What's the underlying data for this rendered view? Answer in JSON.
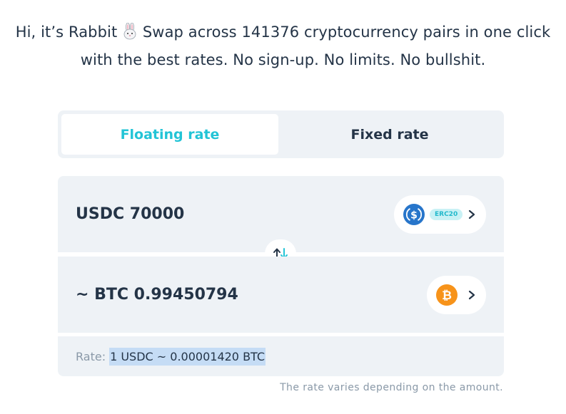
{
  "intro": {
    "line1_before": "Hi, it’s Rabbit",
    "line1_after": "Swap across 141376 cryptocurrency pairs in one click",
    "line2": "with the best rates. No sign-up. No limits. No bullshit."
  },
  "rate_toggle": {
    "floating_label": "Floating rate",
    "fixed_label": "Fixed rate",
    "selected": "Floating rate"
  },
  "send": {
    "amount_text": "USDC 70000",
    "coin_icon": "usdc-icon",
    "network_badge": "ERC20",
    "coin_color": "#2775ca"
  },
  "receive": {
    "amount_text": "~ BTC 0.99450794",
    "coin_icon": "bitcoin-icon",
    "coin_color": "#f7931a"
  },
  "rate": {
    "label": "Rate:",
    "value": "1 USDC ~ 0.00001420 BTC"
  },
  "note": "The rate varies depending on the amount.",
  "colors": {
    "accent": "#22c4d6",
    "panel": "#eef2f6",
    "text": "#243447",
    "muted": "#8a99a8"
  }
}
